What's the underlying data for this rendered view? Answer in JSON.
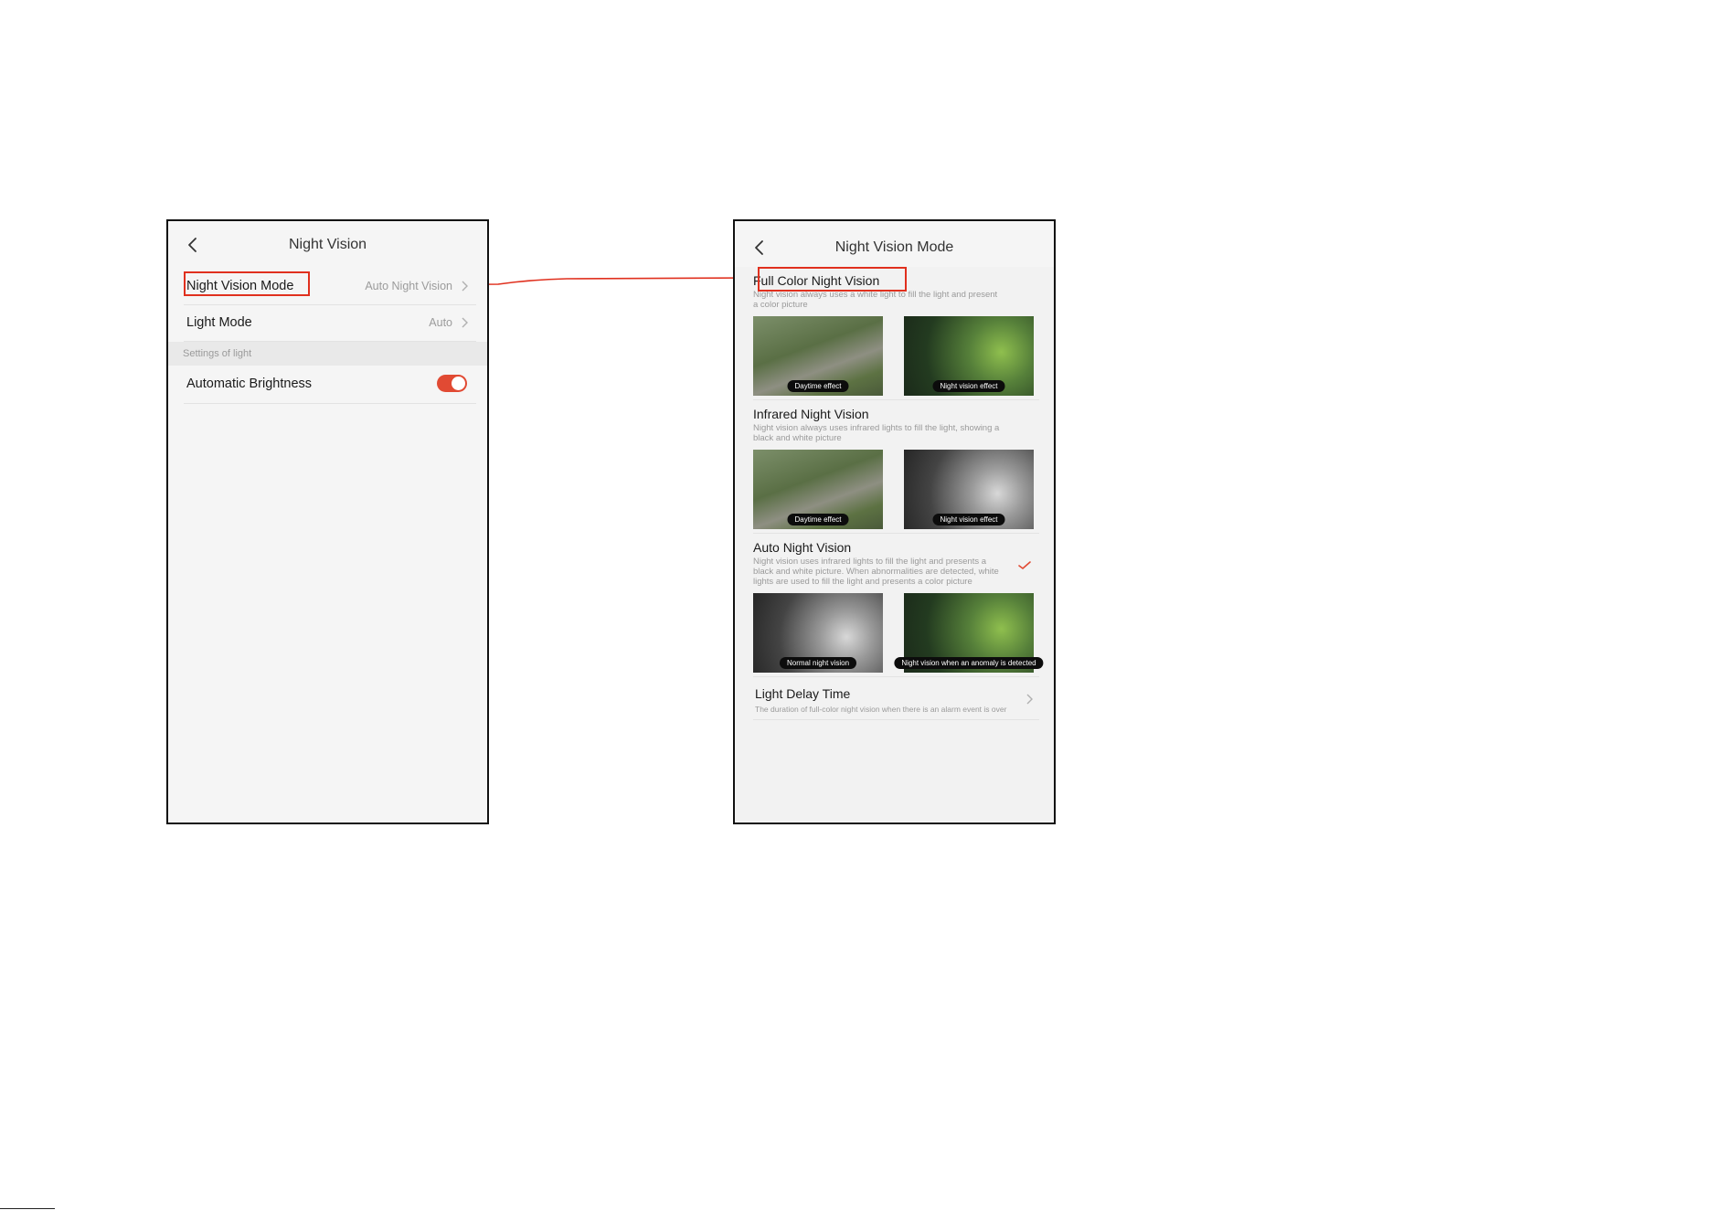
{
  "left_screen": {
    "title": "Night Vision",
    "rows": [
      {
        "label": "Night Vision Mode",
        "value": "Auto Night Vision"
      },
      {
        "label": "Light Mode",
        "value": "Auto"
      }
    ],
    "section_header": "Settings of light",
    "auto_brightness": {
      "label": "Automatic Brightness",
      "enabled": true
    }
  },
  "right_screen": {
    "title": "Night Vision Mode",
    "modes": [
      {
        "title": "Full Color Night Vision",
        "description": "Night vision always uses a white light to fill the light and present a color picture",
        "captions": [
          "Daytime effect",
          "Night vision effect"
        ],
        "selected": false
      },
      {
        "title": "Infrared Night Vision",
        "description": "Night vision always uses infrared lights to fill the light, showing a black and white picture",
        "captions": [
          "Daytime effect",
          "Night vision effect"
        ],
        "selected": false
      },
      {
        "title": "Auto Night Vision",
        "description": "Night vision uses infrared lights to fill the light and presents a black and white picture. When abnormalities are detected, white lights are used to fill the light and presents a color picture",
        "captions": [
          "Normal night vision",
          "Night vision when an anomaly is detected"
        ],
        "selected": true
      }
    ],
    "light_delay": {
      "title": "Light Delay Time",
      "description": "The duration of full-color night vision when there is an alarm event is over"
    }
  },
  "colors": {
    "accent": "#e14a33",
    "annotation": "#e0301e"
  },
  "icons": {
    "back": "chevron-left-icon",
    "forward": "chevron-right-icon",
    "selected": "check-icon"
  }
}
